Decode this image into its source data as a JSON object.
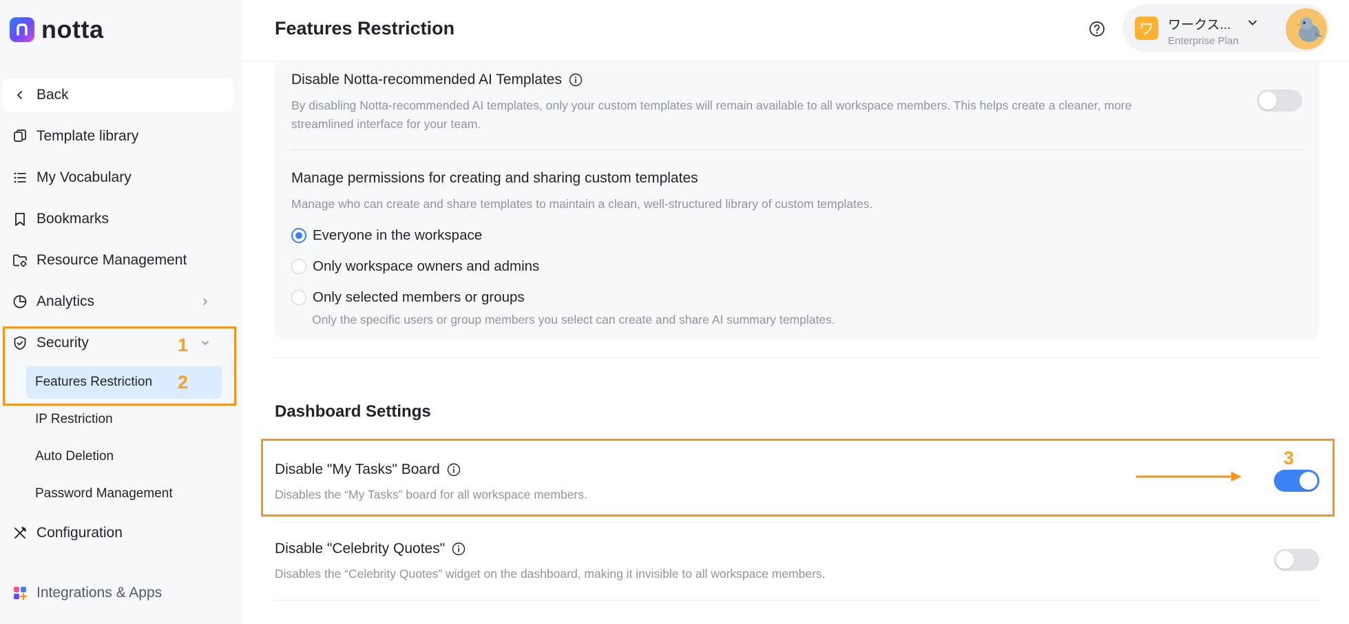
{
  "brand": {
    "name": "notta"
  },
  "sidebar": {
    "back": "Back",
    "items": [
      {
        "label": "Template library",
        "icon": "template-icon"
      },
      {
        "label": "My Vocabulary",
        "icon": "list-icon"
      },
      {
        "label": "Bookmarks",
        "icon": "bookmark-icon"
      },
      {
        "label": "Resource Management",
        "icon": "folder-gear-icon"
      },
      {
        "label": "Analytics",
        "icon": "pie-chart-icon"
      },
      {
        "label": "Security",
        "icon": "shield-icon"
      },
      {
        "label": "Configuration",
        "icon": "tools-icon"
      },
      {
        "label": "Integrations & Apps",
        "icon": "apps-icon"
      }
    ],
    "security_sub": [
      {
        "label": "Features Restriction",
        "active": true
      },
      {
        "label": "IP Restriction"
      },
      {
        "label": "Auto Deletion"
      },
      {
        "label": "Password Management"
      }
    ]
  },
  "header": {
    "title": "Features Restriction",
    "workspace_badge": "ワ",
    "workspace_name": "ワークス...",
    "workspace_plan": "Enterprise Plan"
  },
  "annotations": {
    "one": "1",
    "two": "2",
    "three": "3"
  },
  "colors": {
    "accent": "#3b82f6",
    "highlight": "#f7941d",
    "annotation": "#f7a21b"
  },
  "main": {
    "ai_templates": {
      "title": "Disable Notta-recommended AI Templates",
      "desc_line1": "By disabling Notta-recommended AI templates, only your custom templates will remain available to all workspace members. This helps create a cleaner, more",
      "desc_line2": "streamlined interface for your team.",
      "enabled": false
    },
    "permissions": {
      "title": "Manage permissions for creating and sharing custom templates",
      "desc": "Manage who can create and share templates to maintain a clean, well-structured library of custom templates.",
      "options": [
        {
          "label": "Everyone in the workspace",
          "checked": true
        },
        {
          "label": "Only workspace owners and admins",
          "checked": false
        },
        {
          "label": "Only selected members or groups",
          "checked": false
        }
      ],
      "selected_note": "Only the specific users or group members you select can create and share AI summary templates."
    },
    "dashboard": {
      "section_title": "Dashboard Settings",
      "my_tasks": {
        "title": "Disable \"My Tasks\" Board",
        "desc": "Disables the “My Tasks” board for all workspace members.",
        "enabled": true
      },
      "celebrity_quotes": {
        "title": "Disable \"Celebrity Quotes\"",
        "desc": "Disables the “Celebrity Quotes” widget on the dashboard, making it invisible to all workspace members.",
        "enabled": false
      }
    }
  }
}
